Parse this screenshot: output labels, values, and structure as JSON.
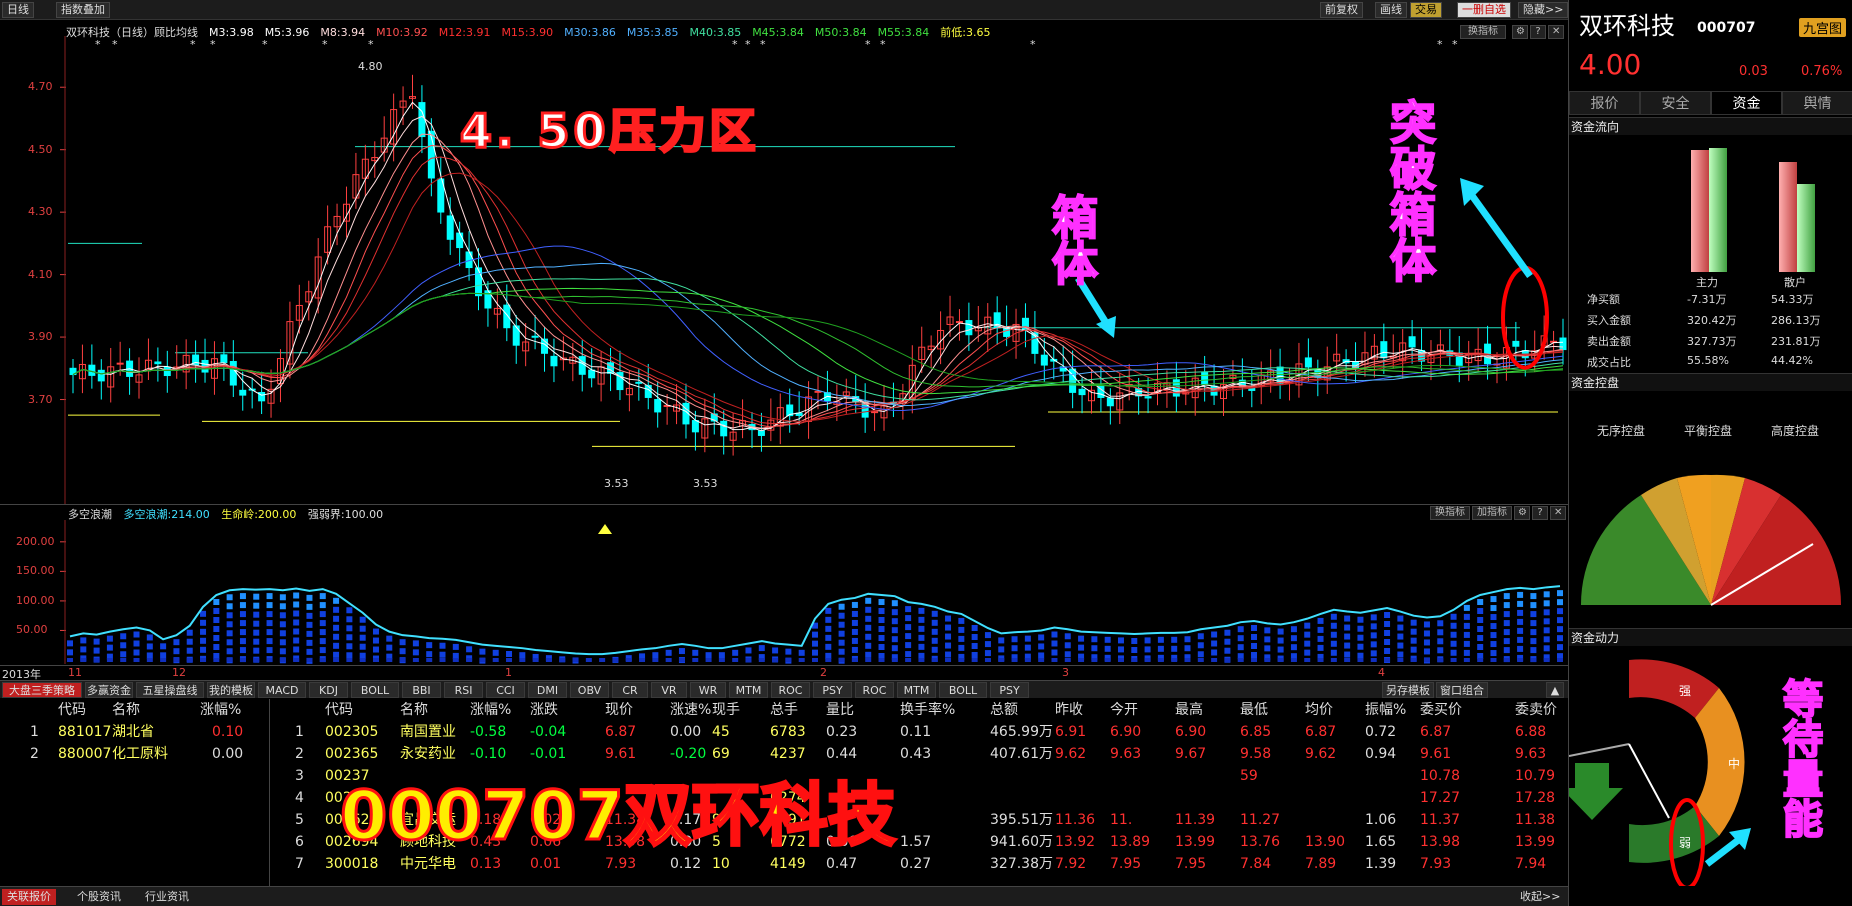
{
  "top_bar": {
    "left": [
      "日线",
      "指数叠加"
    ],
    "right": [
      "前复权",
      "画线",
      "交易",
      "一删自选",
      "隐藏>>"
    ]
  },
  "stock": {
    "name": "双环科技",
    "code": "000707",
    "price": "4.00",
    "change": "0.03",
    "pct": "0.76%",
    "badge": "九宫图"
  },
  "ma_legend": [
    {
      "text": "双环科技（日线）顾比均线",
      "color": "#dddddd"
    },
    {
      "text": "M3:3.98",
      "color": "#ffffff"
    },
    {
      "text": "M5:3.96",
      "color": "#ffffff"
    },
    {
      "text": "M8:3.94",
      "color": "#ffdddd"
    },
    {
      "text": "M10:3.92",
      "color": "#ff5050"
    },
    {
      "text": "M12:3.91",
      "color": "#ff3030"
    },
    {
      "text": "M15:3.90",
      "color": "#ff3030"
    },
    {
      "text": "M30:3.86",
      "color": "#50b0ff"
    },
    {
      "text": "M35:3.85",
      "color": "#50b0ff"
    },
    {
      "text": "M40:3.85",
      "color": "#40e0a0"
    },
    {
      "text": "M45:3.84",
      "color": "#40e040"
    },
    {
      "text": "M50:3.84",
      "color": "#40e040"
    },
    {
      "text": "M55:3.84",
      "color": "#40e040"
    },
    {
      "text": "前低:3.65",
      "color": "#ffff40"
    }
  ],
  "main_chart": {
    "y_ticks": [
      "4.70",
      "4.50",
      "4.30",
      "4.10",
      "3.90",
      "3.70"
    ],
    "high_label": "4.80",
    "low_labels": [
      "3.53",
      "3.53"
    ],
    "btn_switch": "换指标"
  },
  "annotations": {
    "pressure": "4. 50压力区",
    "box": [
      "箱",
      "体"
    ],
    "breakout": [
      "突",
      "破",
      "箱",
      "体"
    ],
    "wait": [
      "等",
      "待",
      "量",
      "能"
    ],
    "big_title": "000707双环科技"
  },
  "indicator": {
    "name": "多空浪潮",
    "v1": "多空浪潮:214.00",
    "v2": "生命岭:200.00",
    "v3": "强弱界:100.00",
    "y_ticks": [
      "200.00",
      "150.00",
      "100.00",
      "50.00"
    ],
    "btn_switch": "换指标",
    "btn_add": "加指标",
    "values": [
      40,
      45,
      43,
      48,
      52,
      55,
      50,
      35,
      42,
      58,
      90,
      110,
      118,
      120,
      119,
      120,
      118,
      121,
      117,
      120,
      112,
      96,
      80,
      60,
      48,
      42,
      40,
      37,
      36,
      34,
      30,
      26,
      24,
      22,
      20,
      17,
      15,
      13,
      11,
      10,
      10,
      12,
      15,
      18,
      20,
      24,
      27,
      24,
      20,
      20,
      24,
      28,
      32,
      28,
      26,
      24,
      70,
      95,
      102,
      105,
      112,
      110,
      108,
      98,
      95,
      90,
      82,
      78,
      66,
      54,
      45,
      47,
      48,
      50,
      55,
      52,
      48,
      47,
      46,
      45,
      44,
      45,
      46,
      46,
      47,
      52,
      55,
      58,
      64,
      66,
      62,
      60,
      64,
      70,
      78,
      85,
      82,
      80,
      84,
      88,
      82,
      75,
      72,
      74,
      85,
      100,
      110,
      115,
      120,
      122,
      120,
      123,
      125
    ]
  },
  "x_axis": {
    "year": "2013年",
    "months": [
      "11",
      "12",
      "1",
      "2",
      "3",
      "4"
    ]
  },
  "right_panel": {
    "tabs": [
      "报价",
      "安全",
      "资金",
      "舆情"
    ],
    "sec_flow": "资金流向",
    "bar_labels": [
      "主力",
      "散户"
    ],
    "rows": [
      {
        "label": "净买额",
        "a": "-7.31万",
        "b": "54.33万"
      },
      {
        "label": "买入金额",
        "a": "320.42万",
        "b": "286.13万"
      },
      {
        "label": "卖出金额",
        "a": "327.73万",
        "b": "231.81万"
      },
      {
        "label": "成交占比",
        "a": "55.58%",
        "b": "44.42%"
      }
    ],
    "sec_control": "资金控盘",
    "control_labels": [
      "无序控盘",
      "平衡控盘",
      "高度控盘"
    ],
    "sec_power": "资金动力",
    "power_labels": [
      "强",
      "中",
      "弱"
    ]
  },
  "bottom_tabs": [
    "大盘三季策略",
    "多赢资金",
    "五星操盘线",
    "我的模板",
    "MACD",
    "KDJ",
    "BOLL",
    "BBI",
    "RSI",
    "CCI",
    "DMI",
    "OBV",
    "CR",
    "VR",
    "WR",
    "MTM",
    "ROC",
    "PSY",
    "ROC",
    "MTM",
    "BOLL",
    "PSY"
  ],
  "bottom_right_tabs": [
    "另存模板",
    "窗口组合"
  ],
  "sector_table": {
    "headers": [
      "代码",
      "名称",
      "涨幅%"
    ],
    "rows": [
      [
        "1",
        "881017",
        "湖北省",
        "0.10"
      ],
      [
        "2",
        "880007",
        "化工原料",
        "0.00"
      ]
    ]
  },
  "stock_table": {
    "headers": [
      "代码",
      "名称",
      "涨幅%",
      "涨跌",
      "现价",
      "涨速%",
      "现手",
      "总手",
      "量比",
      "换手率%",
      "总额",
      "昨收",
      "今开",
      "最高",
      "最低",
      "均价",
      "振幅%",
      "委买价",
      "委卖价"
    ],
    "rows": [
      [
        "1",
        "002305",
        "南国置业",
        "-0.58",
        "-0.04",
        "6.87",
        "0.00",
        "45",
        "6783",
        "0.23",
        "0.11",
        "465.99万",
        "6.91",
        "6.90",
        "6.90",
        "6.85",
        "6.87",
        "0.72",
        "6.87",
        "6.88"
      ],
      [
        "2",
        "002365",
        "永安药业",
        "-0.10",
        "-0.01",
        "9.61",
        "-0.20",
        "69",
        "4237",
        "0.44",
        "0.43",
        "407.61万",
        "9.62",
        "9.63",
        "9.67",
        "9.58",
        "9.62",
        "0.94",
        "9.61",
        "9.63"
      ],
      [
        "3",
        "00237",
        "",
        "",
        "",
        "",
        "",
        "",
        "",
        "",
        "",
        "",
        "",
        "",
        "",
        "59",
        "",
        "",
        "10.78",
        "10.79"
      ],
      [
        "4",
        "002",
        "",
        "",
        "",
        "",
        "",
        "",
        "0274",
        "",
        "",
        "",
        "",
        "",
        "",
        "",
        "",
        "",
        "17.27",
        "17.28"
      ],
      [
        "5",
        "002627",
        "宜昌交运",
        "0.18",
        "0.02",
        "11.38",
        "0.17",
        "9",
        "3491",
        "",
        "",
        "395.51万",
        "11.36",
        "11.",
        "11.39",
        "11.27",
        "",
        "1.06",
        "11.37",
        "11.38"
      ],
      [
        "6",
        "002694",
        "顾地科技",
        "0.43",
        "0.06",
        "13.98",
        "0.00",
        "5",
        "6772",
        "0.66",
        "1.57",
        "941.60万",
        "13.92",
        "13.89",
        "13.99",
        "13.76",
        "13.90",
        "1.65",
        "13.98",
        "13.99"
      ],
      [
        "7",
        "300018",
        "中元华电",
        "0.13",
        "0.01",
        "7.93",
        "0.12",
        "10",
        "4149",
        "0.47",
        "0.27",
        "327.38万",
        "7.92",
        "7.95",
        "7.95",
        "7.84",
        "7.89",
        "1.39",
        "7.93",
        "7.94"
      ]
    ]
  },
  "footer": {
    "tabs": [
      "关联报价",
      "个股资讯",
      "行业资讯"
    ],
    "right": "收起>>"
  },
  "colors": {
    "up": "#ff3030",
    "down": "#00ff40",
    "flat": "#dddddd",
    "candle_down": "#00ffff",
    "accent_magenta": "#ff30ff"
  }
}
